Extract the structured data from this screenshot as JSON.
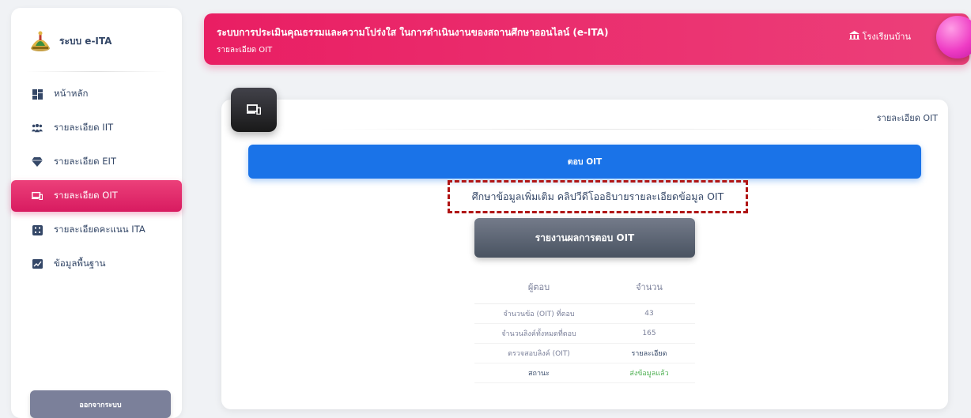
{
  "sidebar": {
    "brand": "ระบบ e-ITA",
    "items": [
      {
        "label": "หน้าหลัก",
        "icon": "dashboard-icon",
        "active": false
      },
      {
        "label": "รายละเอียด IIT",
        "icon": "users-icon",
        "active": false
      },
      {
        "label": "รายละเอียด EIT",
        "icon": "diamond-icon",
        "active": false
      },
      {
        "label": "รายละเอียด OIT",
        "icon": "devices-icon",
        "active": true
      },
      {
        "label": "รายละเอียดคะแนน ITA",
        "icon": "calculator-icon",
        "active": false
      },
      {
        "label": "ข้อมูลพื้นฐาน",
        "icon": "chart-icon",
        "active": false
      }
    ],
    "logout": "ออกจากระบบ"
  },
  "header": {
    "title": "ระบบการประเมินคุณธรรมและความโปร่งใส ในการดำเนินงานของสถานศึกษาออนไลน์ (e-ITA)",
    "subtitle": "รายละเอียด OIT",
    "school": "โรงเรียนบ้าน"
  },
  "card": {
    "title": "รายละเอียด OIT",
    "answer_button": "ตอบ OIT",
    "info_link": "ศึกษาข้อมูลเพิ่มเติม คลิปวีดีโออธิบายรายละเอียดข้อมูล OIT",
    "report_button": "รายงานผลการตอบ OIT",
    "table": {
      "headers": [
        "ผู้ตอบ",
        "จำนวน"
      ],
      "rows": [
        [
          "จำนวนข้อ (OIT) ที่ตอบ",
          "43"
        ],
        [
          "จำนวนลิงค์ทั้งหมดที่ตอบ",
          "165"
        ],
        [
          "ตรวจสอบลิงค์ (OIT)",
          "รายละเอียด"
        ],
        [
          "สถานะ",
          "ส่งข้อมูลแล้ว"
        ]
      ]
    }
  },
  "colors": {
    "accent": "#e91e63",
    "primary_button": "#1a73e8",
    "report_button": "#495361",
    "status_sent": "#4caf50",
    "highlight_box": "#b01515"
  }
}
